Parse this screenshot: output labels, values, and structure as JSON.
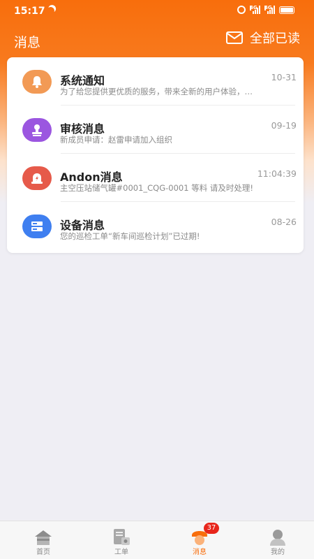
{
  "status_bar": {
    "time": "15:17"
  },
  "header": {
    "title": "消息",
    "mark_all_read": "全部已读"
  },
  "messages": [
    {
      "title": "系统通知",
      "time": "10-31",
      "preview": "为了给您提供更优质的服务，带来全新的用户体验，…",
      "icon": "bell-icon",
      "color": "#f29a55"
    },
    {
      "title": "审核消息",
      "time": "09-19",
      "preview": "新成员申请：赵雷申请加入组织",
      "icon": "stamp-icon",
      "color": "#9b56e0"
    },
    {
      "title": "Andon消息",
      "time": "11:04:39",
      "preview": "主空压站储气罐#0001_CQG-0001 等料 请及时处理!",
      "icon": "alarm-lamp-icon",
      "color": "#e65a4a"
    },
    {
      "title": "设备消息",
      "time": "08-26",
      "preview": "您的巡检工单“新车间巡检计划”已过期!",
      "icon": "device-icon",
      "color": "#3f7ff0"
    }
  ],
  "tabbar": {
    "items": [
      {
        "label": "首页",
        "icon": "home-icon"
      },
      {
        "label": "工单",
        "icon": "work-order-icon"
      },
      {
        "label": "消息",
        "icon": "message-icon",
        "badge": "37"
      },
      {
        "label": "我的",
        "icon": "profile-icon"
      }
    ],
    "active_color": "#f86e0c"
  },
  "colors": {
    "primary": "#f86e0c",
    "badge": "#e8261b"
  }
}
